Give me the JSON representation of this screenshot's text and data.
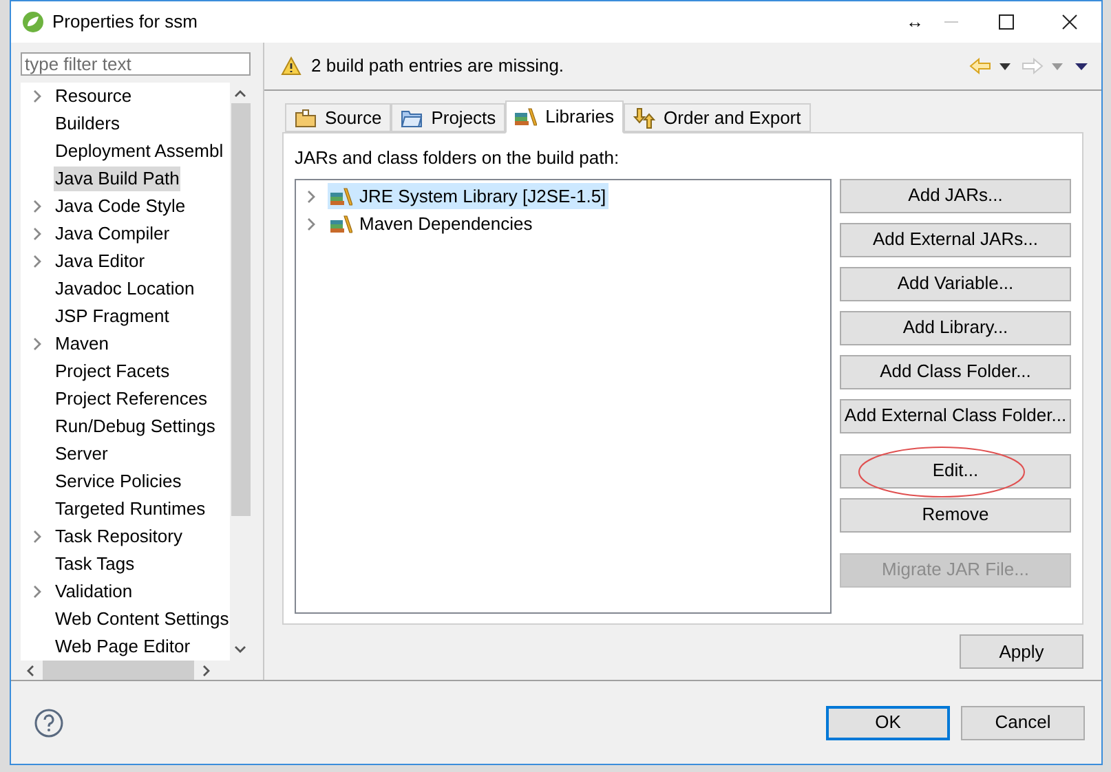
{
  "window": {
    "title": "Properties for ssm",
    "buttons": [
      "↔"
    ]
  },
  "filter": {
    "placeholder": "type filter text"
  },
  "sidebar": {
    "items": [
      {
        "label": "Resource",
        "expandable": true,
        "selected": false
      },
      {
        "label": "Builders",
        "expandable": false,
        "selected": false
      },
      {
        "label": "Deployment Assembl",
        "expandable": false,
        "selected": false
      },
      {
        "label": "Java Build Path",
        "expandable": false,
        "selected": true
      },
      {
        "label": "Java Code Style",
        "expandable": true,
        "selected": false
      },
      {
        "label": "Java Compiler",
        "expandable": true,
        "selected": false
      },
      {
        "label": "Java Editor",
        "expandable": true,
        "selected": false
      },
      {
        "label": "Javadoc Location",
        "expandable": false,
        "selected": false
      },
      {
        "label": "JSP Fragment",
        "expandable": false,
        "selected": false
      },
      {
        "label": "Maven",
        "expandable": true,
        "selected": false
      },
      {
        "label": "Project Facets",
        "expandable": false,
        "selected": false
      },
      {
        "label": "Project References",
        "expandable": false,
        "selected": false
      },
      {
        "label": "Run/Debug Settings",
        "expandable": false,
        "selected": false
      },
      {
        "label": "Server",
        "expandable": false,
        "selected": false
      },
      {
        "label": "Service Policies",
        "expandable": false,
        "selected": false
      },
      {
        "label": "Targeted Runtimes",
        "expandable": false,
        "selected": false
      },
      {
        "label": "Task Repository",
        "expandable": true,
        "selected": false
      },
      {
        "label": "Task Tags",
        "expandable": false,
        "selected": false
      },
      {
        "label": "Validation",
        "expandable": true,
        "selected": false
      },
      {
        "label": "Web Content Settings",
        "expandable": false,
        "selected": false
      },
      {
        "label": "Web Page Editor",
        "expandable": false,
        "selected": false
      }
    ]
  },
  "message": {
    "text": "2 build path entries are missing."
  },
  "tabs": [
    {
      "label": "Source",
      "kind": "source",
      "selected": false
    },
    {
      "label": "Projects",
      "kind": "projects",
      "selected": false
    },
    {
      "label": "Libraries",
      "kind": "libraries",
      "selected": true
    },
    {
      "label": "Order and Export",
      "kind": "order",
      "selected": false
    }
  ],
  "libraries": {
    "caption": "JARs and class folders on the build path:",
    "entries": [
      {
        "label": "JRE System Library [J2SE-1.5]",
        "selected": true
      },
      {
        "label": "Maven Dependencies",
        "selected": false
      }
    ],
    "button_groups": [
      [
        {
          "label": "Add JARs...",
          "disabled": false,
          "circled": false
        },
        {
          "label": "Add External JARs...",
          "disabled": false,
          "circled": false
        },
        {
          "label": "Add Variable...",
          "disabled": false,
          "circled": false
        },
        {
          "label": "Add Library...",
          "disabled": false,
          "circled": false
        },
        {
          "label": "Add Class Folder...",
          "disabled": false,
          "circled": false
        },
        {
          "label": "Add External Class Folder...",
          "disabled": false,
          "circled": false
        }
      ],
      [
        {
          "label": "Edit...",
          "disabled": false,
          "circled": true
        },
        {
          "label": "Remove",
          "disabled": false,
          "circled": false
        }
      ],
      [
        {
          "label": "Migrate JAR File...",
          "disabled": true,
          "circled": false
        }
      ]
    ]
  },
  "apply": {
    "label": "Apply"
  },
  "footer": {
    "buttons": [
      {
        "label": "OK",
        "default": true
      },
      {
        "label": "Cancel",
        "default": false
      }
    ]
  }
}
